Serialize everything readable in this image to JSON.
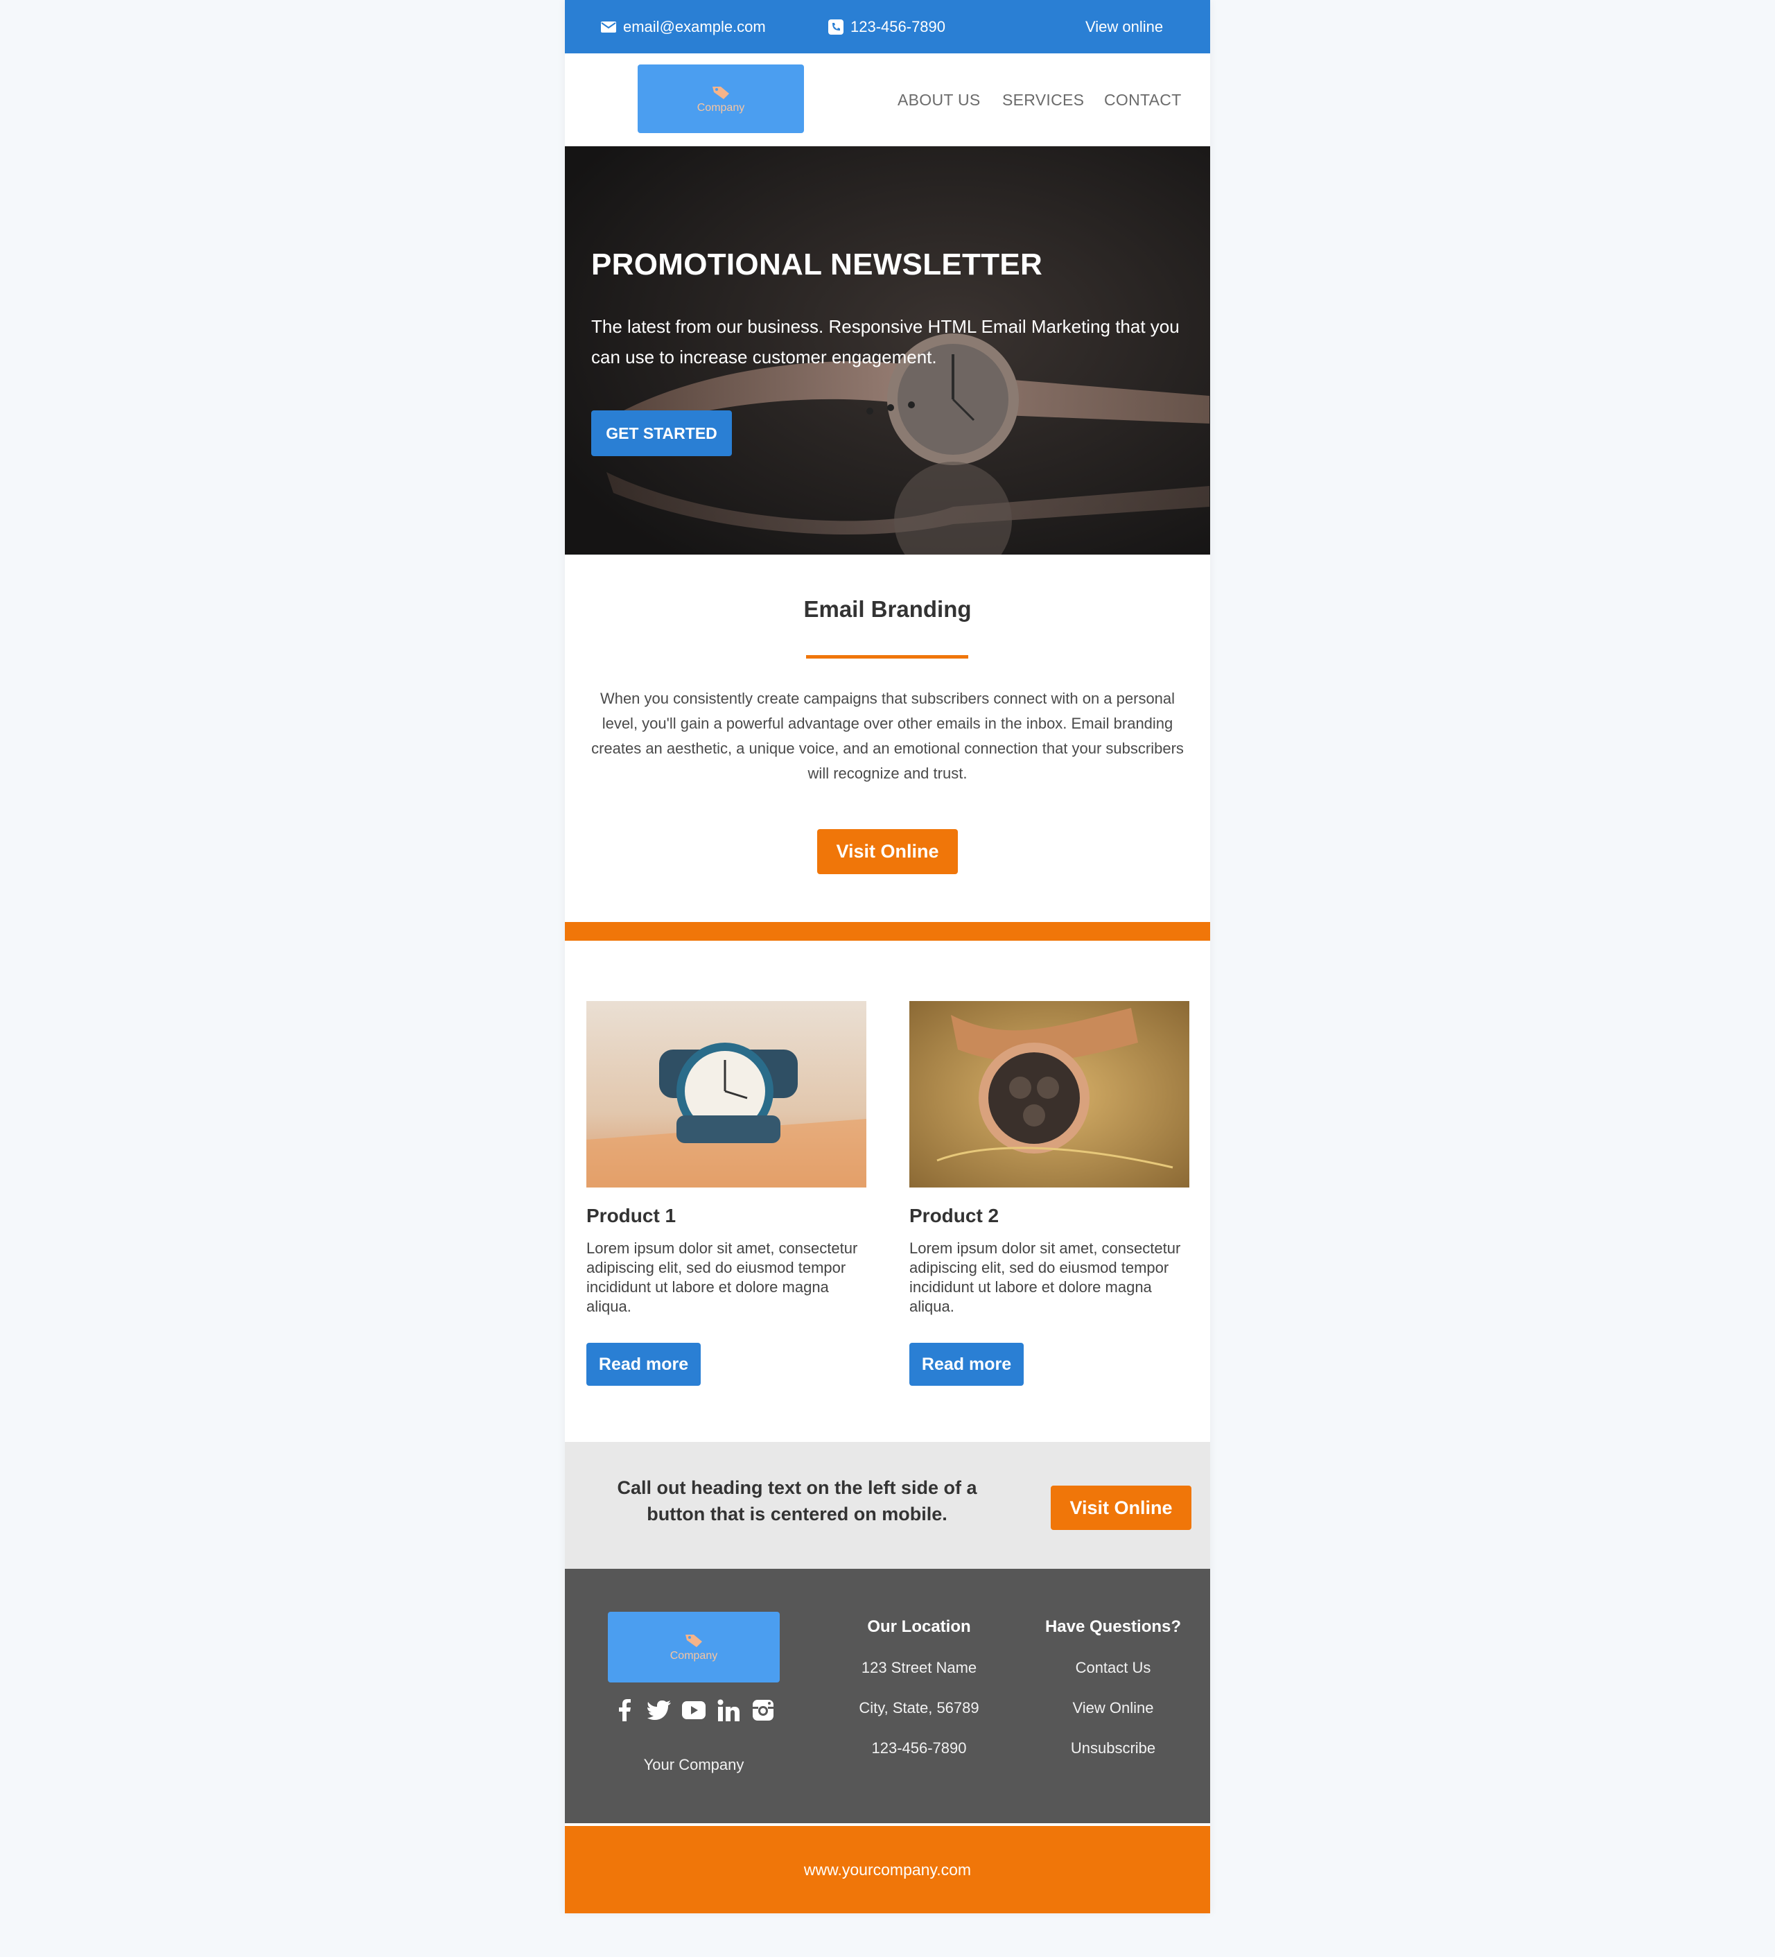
{
  "topbar": {
    "email": "email@example.com",
    "phone": "123-456-7890",
    "view_online": "View online"
  },
  "logo": {
    "name": "Company"
  },
  "nav": [
    "ABOUT US",
    "SERVICES",
    "CONTACT"
  ],
  "hero": {
    "title": "PROMOTIONAL NEWSLETTER",
    "subtitle": "The latest from our business. Responsive HTML Email Marketing that you can use to increase customer engagement.",
    "button": "GET STARTED"
  },
  "branding": {
    "title": "Email Branding",
    "text": "When you consistently create campaigns that subscribers connect with on a personal level, you'll gain a powerful advantage over other emails in the inbox. Email branding creates an aesthetic, a unique voice, and an emotional connection that your subscribers will recognize and trust.",
    "button": "Visit Online"
  },
  "products": [
    {
      "title": "Product 1",
      "text": "Lorem ipsum dolor sit amet, consectetur adipiscing elit, sed do eiusmod tempor incididunt ut labore et dolore magna aliqua.",
      "button": "Read more"
    },
    {
      "title": "Product 2",
      "text": "Lorem ipsum dolor sit amet, consectetur adipiscing elit, sed do eiusmod tempor incididunt ut labore et dolore magna aliqua.",
      "button": "Read more"
    }
  ],
  "callout": {
    "text": "Call out heading text on the left side of a button that is centered on mobile.",
    "button": "Visit Online"
  },
  "footer": {
    "company": "Your Company",
    "location": {
      "heading": "Our Location",
      "lines": [
        "123 Street Name",
        "City, State, 56789",
        "123-456-7890"
      ]
    },
    "questions": {
      "heading": "Have Questions?",
      "links": [
        "Contact Us",
        "View Online",
        "Unsubscribe"
      ]
    },
    "social": [
      "facebook-icon",
      "twitter-icon",
      "youtube-icon",
      "linkedin-icon",
      "instagram-icon"
    ]
  },
  "website": "www.yourcompany.com",
  "colors": {
    "blue": "#2a7fd4",
    "orange": "#f07609",
    "footer": "#575757",
    "callout": "#e8e8e8",
    "logo": "#4b9ef0"
  }
}
